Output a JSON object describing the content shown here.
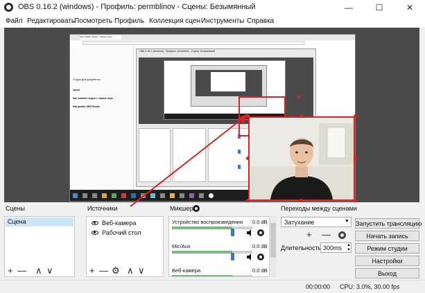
{
  "window": {
    "title": "OBS 0.16.2 (windows) - Профиль: permblinov - Сцены: Безымянный",
    "controls": {
      "minimize": "—",
      "maximize": "☐",
      "close": "✕"
    }
  },
  "menu": [
    "Файл",
    "Редактировать",
    "Посмотреть",
    "Профиль",
    "Коллекция сцен",
    "Инструменты",
    "Справка"
  ],
  "scenes": {
    "title": "Сцены",
    "items": [
      "Сцена"
    ],
    "controls": {
      "add": "+",
      "remove": "—",
      "up": "∧",
      "down": "∨"
    }
  },
  "sources": {
    "title": "Источники",
    "items": [
      "Веб-камера",
      "Рабочий стол"
    ],
    "controls": {
      "add": "+",
      "remove": "—",
      "settings": "⚙",
      "up": "∧",
      "down": "∨"
    }
  },
  "mixer": {
    "title": "Микшер",
    "channels": [
      {
        "name": "Устройство воспроизведения",
        "level": "0.0 dB",
        "volume": 0.75
      },
      {
        "name": "Mic/Aux",
        "level": "0.0 dB",
        "volume": 0.75
      },
      {
        "name": "Веб-камера",
        "level": "0.0 dB",
        "volume": 0.75
      }
    ]
  },
  "transitions": {
    "title": "Переходы между сценами",
    "selected": "Затухание",
    "controls": {
      "add": "+",
      "remove": "—"
    },
    "duration_label": "Длительность",
    "duration_value": "300ms"
  },
  "controls": {
    "start_stream": "Запустить трансляцию",
    "start_record": "Начать запись",
    "studio_mode": "Режим студии",
    "settings": "Настройки",
    "exit": "Выход"
  },
  "status": {
    "time": "00:00:00",
    "cpu": "CPU: 3.0%, 30.00 fps"
  },
  "capture": {
    "browser_tab": "Как снимать видео с экрана черe...",
    "doc_title": "Структура документа",
    "doc_lines": [
      "Уроки",
      "Как снимать видео с экрана черe...",
      "Настройки OBS Studio"
    ],
    "inner_title": "OBS 0.16.2 (windows) - Профиль: permblinov - Сцены: Безымянный"
  },
  "colors": {
    "preview_bg": "#4a4a4a",
    "selection": "#e02020",
    "selected_row": "#cde6f7",
    "volume_knob": "#2a7ad6"
  }
}
